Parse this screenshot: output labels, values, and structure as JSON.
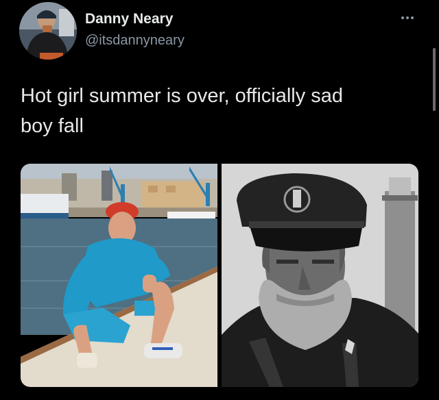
{
  "tweet": {
    "author_name": "Danny Neary",
    "author_handle": "@itsdannyneary",
    "text": "Hot girl summer is over, officially sad\nboy fall"
  },
  "media": {
    "photos": [
      {
        "subject": "man in blue tracksuit and red beanie crouching by harbor"
      },
      {
        "subject": "black and white portrait of bearded sailor in captain hat"
      }
    ]
  },
  "icons": {
    "more": "more-options-icon"
  },
  "colors": {
    "background": "#000000",
    "primary_text": "#e7e9ea",
    "secondary_text": "#8b98a5"
  }
}
